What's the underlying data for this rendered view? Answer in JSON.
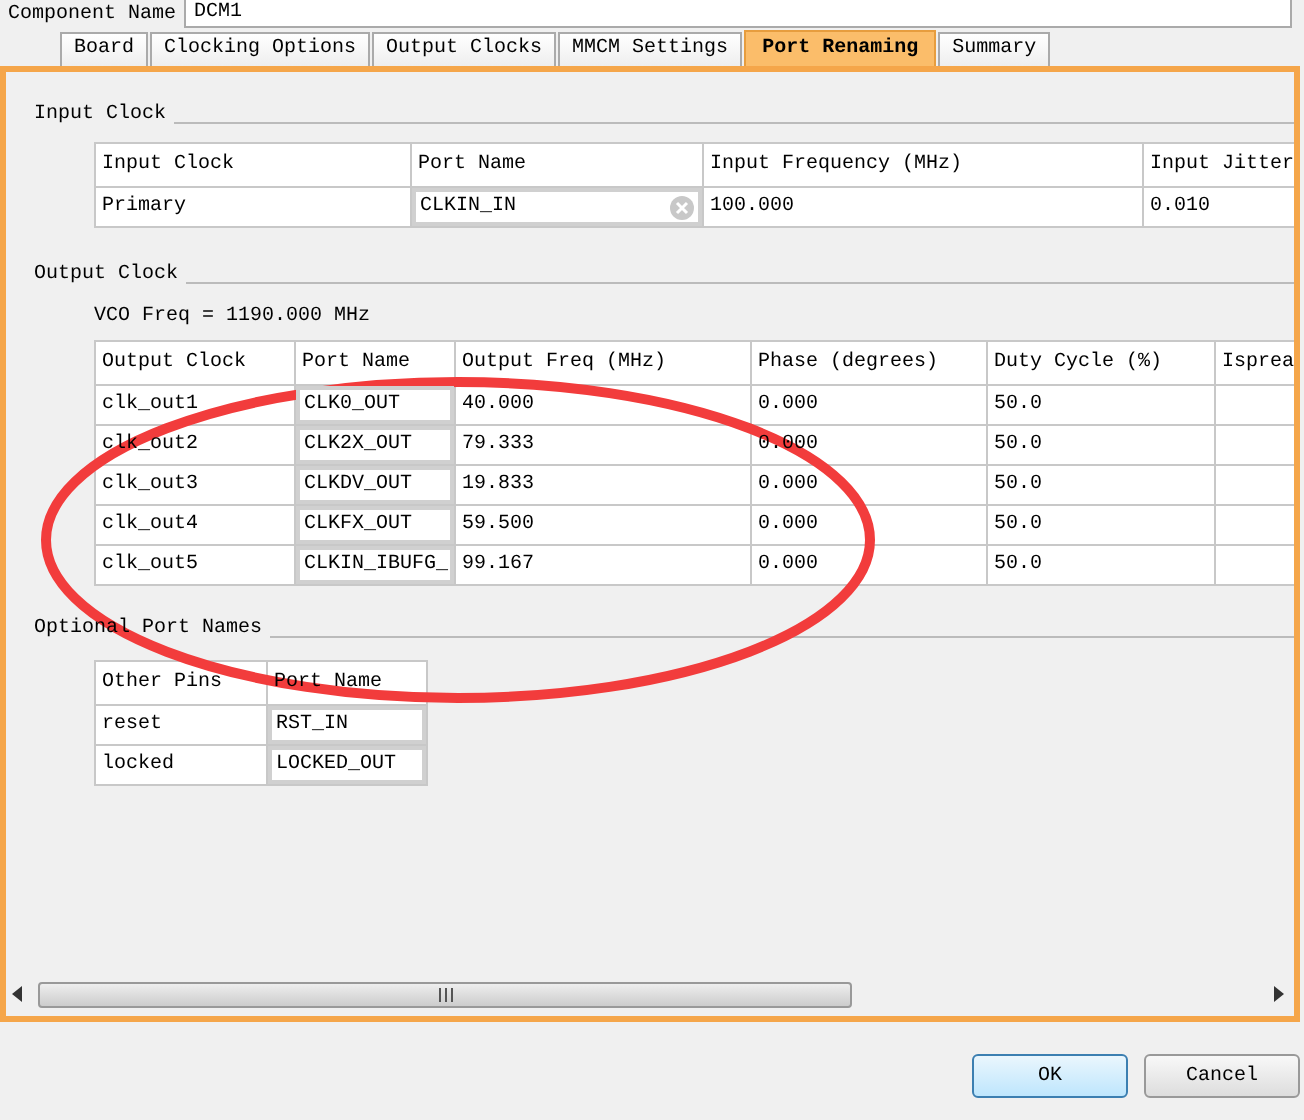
{
  "component": {
    "label": "Component Name",
    "value": "DCM1"
  },
  "tabs": [
    {
      "label": "Board",
      "selected": false
    },
    {
      "label": "Clocking Options",
      "selected": false
    },
    {
      "label": "Output Clocks",
      "selected": false
    },
    {
      "label": "MMCM Settings",
      "selected": false
    },
    {
      "label": "Port Renaming",
      "selected": true
    },
    {
      "label": "Summary",
      "selected": false
    }
  ],
  "input_clock": {
    "title": "Input Clock",
    "columns": [
      "Input Clock",
      "Port Name",
      "Input Frequency (MHz)",
      "Input Jitter"
    ],
    "rows": [
      {
        "clock": "Primary",
        "port": "CLKIN_IN",
        "frequency": "100.000",
        "jitter": "0.010"
      }
    ]
  },
  "output_clock": {
    "title": "Output Clock",
    "vco": "VCO Freq = 1190.000 MHz",
    "columns": [
      "Output Clock",
      "Port Name",
      "Output Freq (MHz)",
      "Phase (degrees)",
      "Duty Cycle (%)",
      "Isprea"
    ],
    "rows": [
      {
        "clock": "clk_out1",
        "port": "CLK0_OUT",
        "freq": "40.000",
        "phase": "0.000",
        "duty": "50.0"
      },
      {
        "clock": "clk_out2",
        "port": "CLK2X_OUT",
        "freq": "79.333",
        "phase": "0.000",
        "duty": "50.0"
      },
      {
        "clock": "clk_out3",
        "port": "CLKDV_OUT",
        "freq": "19.833",
        "phase": "0.000",
        "duty": "50.0"
      },
      {
        "clock": "clk_out4",
        "port": "CLKFX_OUT",
        "freq": "59.500",
        "phase": "0.000",
        "duty": "50.0"
      },
      {
        "clock": "clk_out5",
        "port": "CLKIN_IBUFG_",
        "freq": "99.167",
        "phase": "0.000",
        "duty": "50.0"
      }
    ]
  },
  "optional": {
    "title": "Optional Port Names",
    "columns": [
      "Other Pins",
      "Port Name"
    ],
    "rows": [
      {
        "pin": "reset",
        "port": "RST_IN"
      },
      {
        "pin": "locked",
        "port": "LOCKED_OUT"
      }
    ]
  },
  "buttons": [
    "OK",
    "Cancel"
  ]
}
